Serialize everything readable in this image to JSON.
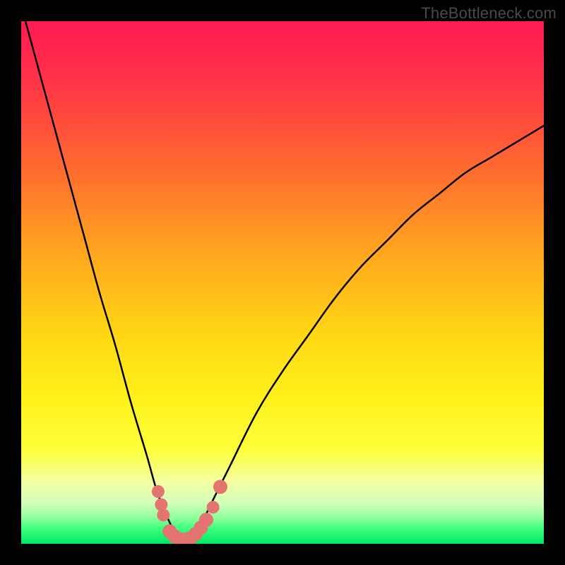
{
  "watermark": "TheBottleneck.com",
  "chart_data": {
    "type": "line",
    "title": "",
    "xlabel": "",
    "ylabel": "",
    "xlim": [
      0,
      100
    ],
    "ylim": [
      0,
      100
    ],
    "grid": false,
    "series": [
      {
        "name": "bottleneck-curve",
        "x": [
          0,
          3,
          6,
          9,
          12,
          15,
          18,
          21,
          24,
          26,
          28,
          29,
          30,
          31,
          32,
          33,
          35,
          37,
          40,
          45,
          50,
          55,
          60,
          65,
          70,
          75,
          80,
          85,
          90,
          95,
          100
        ],
        "values": [
          103,
          92,
          81,
          70,
          59,
          48,
          38,
          27,
          17,
          10,
          5,
          3,
          1.5,
          0.8,
          1.2,
          2.2,
          5,
          9,
          15,
          25,
          33,
          40,
          47,
          53,
          58,
          63,
          67,
          71,
          74,
          77,
          80
        ]
      }
    ],
    "background_gradient": {
      "stops": [
        {
          "offset": 0.0,
          "color": "#ff1a52"
        },
        {
          "offset": 0.12,
          "color": "#ff3547"
        },
        {
          "offset": 0.28,
          "color": "#ff6a30"
        },
        {
          "offset": 0.45,
          "color": "#ffa81e"
        },
        {
          "offset": 0.6,
          "color": "#ffd714"
        },
        {
          "offset": 0.72,
          "color": "#fff11a"
        },
        {
          "offset": 0.82,
          "color": "#fdff3a"
        },
        {
          "offset": 0.88,
          "color": "#f4ffa0"
        },
        {
          "offset": 0.92,
          "color": "#d6ffba"
        },
        {
          "offset": 0.95,
          "color": "#90ff9c"
        },
        {
          "offset": 0.97,
          "color": "#3fff7e"
        },
        {
          "offset": 1.0,
          "color": "#00e765"
        }
      ]
    },
    "markers": [
      {
        "x": 26.2,
        "y": 10.0,
        "r": 9
      },
      {
        "x": 26.8,
        "y": 7.5,
        "r": 9
      },
      {
        "x": 27.2,
        "y": 5.5,
        "r": 9
      },
      {
        "x": 28.4,
        "y": 2.4,
        "r": 10
      },
      {
        "x": 29.4,
        "y": 1.4,
        "r": 10
      },
      {
        "x": 30.4,
        "y": 0.9,
        "r": 10
      },
      {
        "x": 31.4,
        "y": 0.8,
        "r": 10
      },
      {
        "x": 32.4,
        "y": 1.1,
        "r": 10
      },
      {
        "x": 33.4,
        "y": 1.9,
        "r": 10
      },
      {
        "x": 34.4,
        "y": 3.1,
        "r": 10
      },
      {
        "x": 35.4,
        "y": 4.6,
        "r": 10
      },
      {
        "x": 36.7,
        "y": 7.0,
        "r": 9
      },
      {
        "x": 38.1,
        "y": 10.9,
        "r": 10
      }
    ],
    "marker_color": "#e3746f"
  }
}
